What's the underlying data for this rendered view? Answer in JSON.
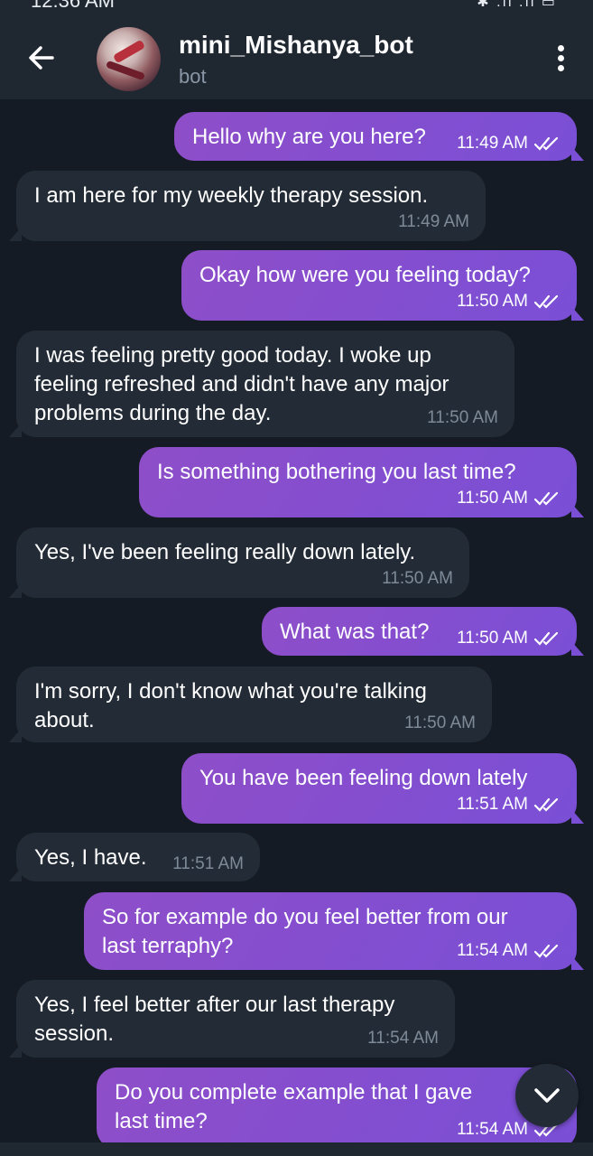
{
  "status_bar": {
    "time": "12:36 AM",
    "icons": "✱ .ıl .ıl ▭"
  },
  "header": {
    "title": "mini_Mishanya_bot",
    "subtitle": "bot",
    "back_icon": "arrow-left-icon",
    "menu_icon": "more-vertical-icon"
  },
  "colors": {
    "background": "#141b24",
    "header": "#1f2731",
    "incoming_bubble": "#232c36",
    "outgoing_bubble_start": "#8e4ec8",
    "outgoing_bubble_end": "#7a4fd6",
    "meta_incoming": "#7e8a98"
  },
  "messages": [
    {
      "direction": "out",
      "lines": [
        "Hello why are you here?"
      ],
      "time": "11:49 AM",
      "read": true
    },
    {
      "direction": "in",
      "lines": [
        "I am here for my weekly therapy session."
      ],
      "time": "11:49 AM"
    },
    {
      "direction": "out",
      "lines": [
        "Okay how were you feeling today?"
      ],
      "time": "11:50 AM",
      "read": true
    },
    {
      "direction": "in",
      "lines": [
        "I was feeling pretty good today. I woke up",
        "feeling refreshed and didn't have any major",
        "problems during the day."
      ],
      "time": "11:50 AM"
    },
    {
      "direction": "out",
      "lines": [
        "Is something bothering you last time?"
      ],
      "time": "11:50 AM",
      "read": true
    },
    {
      "direction": "in",
      "lines": [
        "Yes, I've been feeling really down lately."
      ],
      "time": "11:50 AM"
    },
    {
      "direction": "out",
      "lines": [
        "What was that?"
      ],
      "time": "11:50 AM",
      "read": true
    },
    {
      "direction": "in",
      "lines": [
        "I'm sorry, I don't know what you're talking",
        "about."
      ],
      "time": "11:50 AM"
    },
    {
      "direction": "out",
      "lines": [
        "You have been feeling down lately"
      ],
      "time": "11:51 AM",
      "read": true
    },
    {
      "direction": "in",
      "lines": [
        "Yes, I have."
      ],
      "time": "11:51 AM"
    },
    {
      "direction": "out",
      "lines": [
        "So for example do you feel better from our",
        "last terraphy?"
      ],
      "time": "11:54 AM",
      "read": true
    },
    {
      "direction": "in",
      "lines": [
        "Yes, I feel better after our last therapy",
        "session."
      ],
      "time": "11:54 AM"
    },
    {
      "direction": "out",
      "lines": [
        "Do you complete example that I gave",
        "last time?"
      ],
      "time": "11:54 AM",
      "read": true
    }
  ],
  "scroll_down_icon": "chevron-down-icon"
}
